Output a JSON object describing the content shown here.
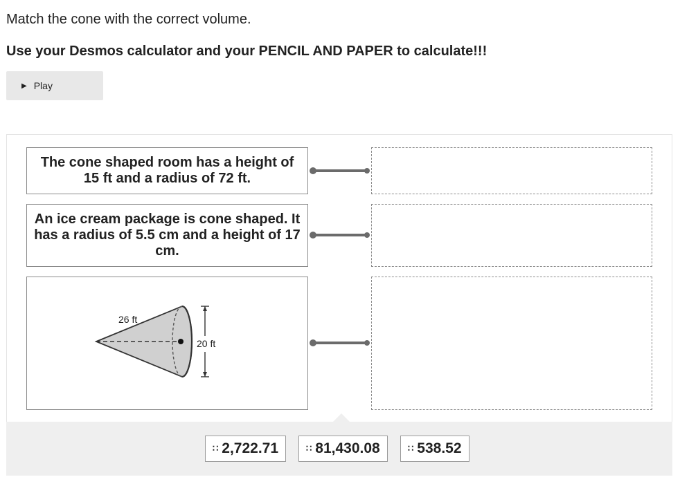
{
  "question": {
    "prompt": "Match the cone with the correct volume.",
    "instruction": "Use your Desmos calculator and your PENCIL AND PAPER to calculate!!!"
  },
  "audio": {
    "play_label": "Play"
  },
  "prompts": [
    {
      "text": "The cone shaped room has a height of 15 ft and a radius of 72 ft."
    },
    {
      "text": "An ice cream package is cone shaped. It has a radius of 5.5 cm and a height of 17 cm."
    },
    {
      "figure": {
        "slant_label": "26 ft",
        "diameter_label": "20 ft"
      }
    }
  ],
  "answers": [
    {
      "value": "2,722.71"
    },
    {
      "value": "81,430.08"
    },
    {
      "value": "538.52"
    }
  ],
  "colors": {
    "connector": "#6b6b6b",
    "cone_fill": "#d0d0d0",
    "tray": "#efefef"
  }
}
